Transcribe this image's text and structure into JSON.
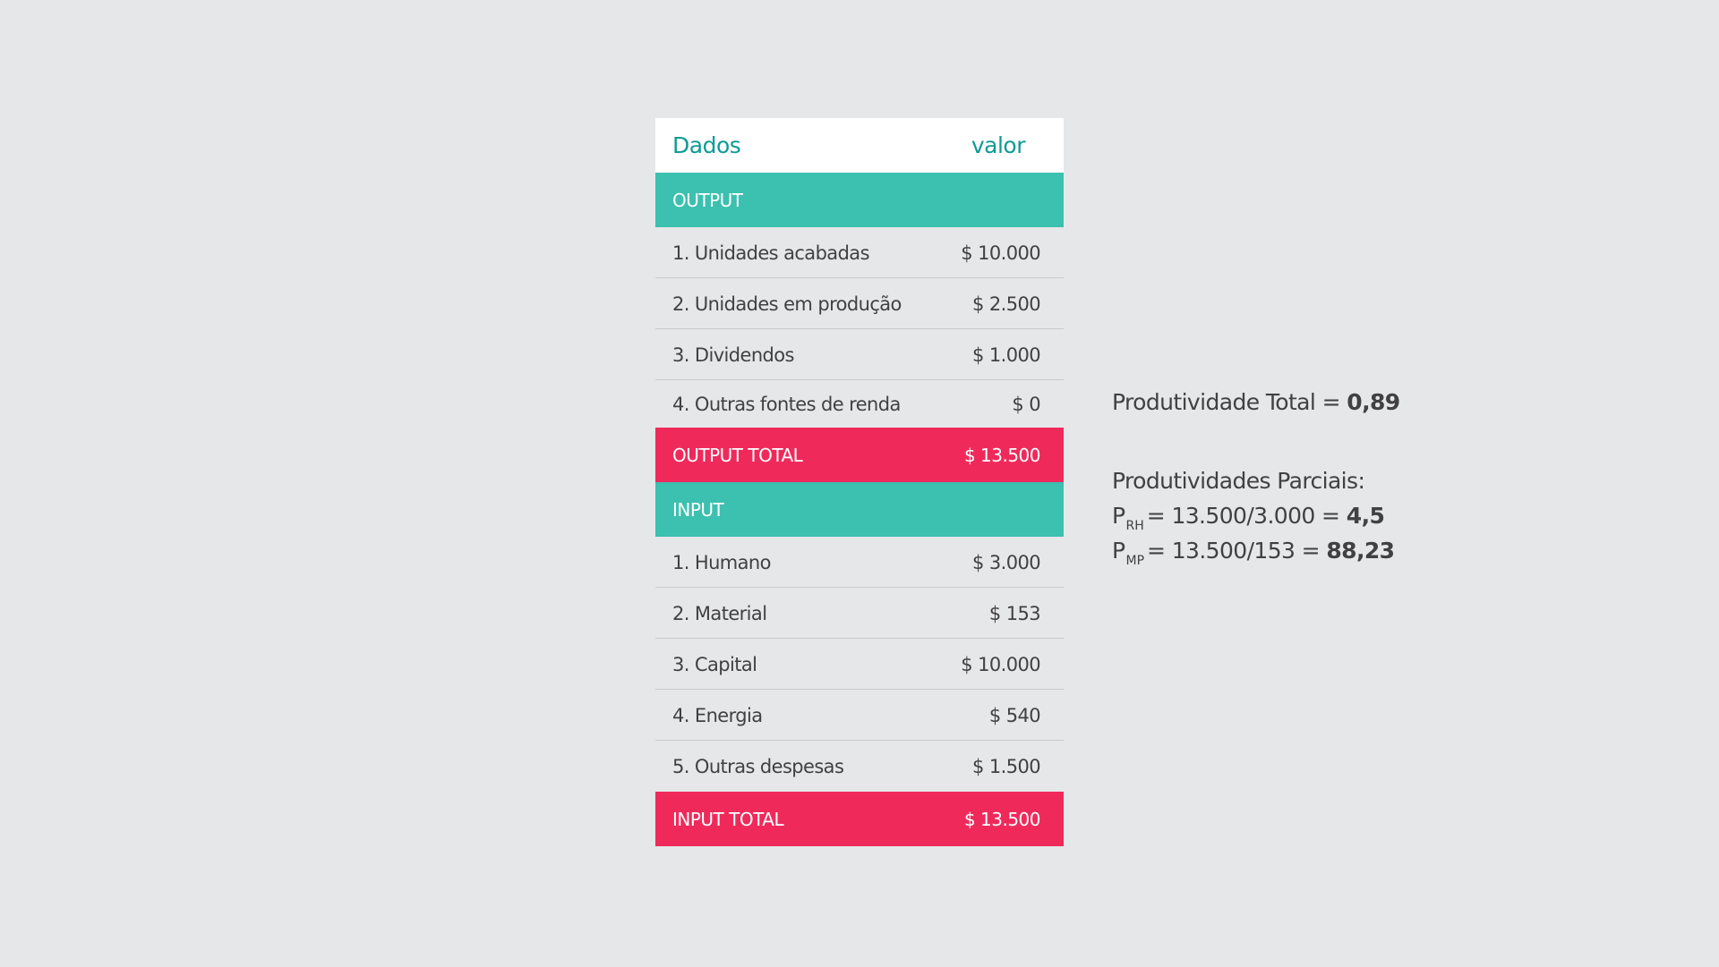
{
  "table": {
    "header": {
      "col1": "Dados",
      "col2": "valor"
    },
    "output_section": {
      "label": "OUTPUT"
    },
    "output_items": [
      {
        "label": "1. Unidades acabadas",
        "value": "$ 10.000"
      },
      {
        "label": "2. Unidades em produção",
        "value": "$ 2.500"
      },
      {
        "label": "3. Dividendos",
        "value": "$ 1.000"
      },
      {
        "label": "4. Outras fontes de renda",
        "value": "$ 0"
      }
    ],
    "output_total": {
      "label": "OUTPUT TOTAL",
      "value": "$ 13.500"
    },
    "input_section": {
      "label": "INPUT"
    },
    "input_items": [
      {
        "label": "1. Humano",
        "value": "$ 3.000"
      },
      {
        "label": "2. Material",
        "value": "$ 153"
      },
      {
        "label": "3. Capital",
        "value": "$ 10.000"
      },
      {
        "label": "4. Energia",
        "value": "$ 540"
      },
      {
        "label": "5. Outras despesas",
        "value": "$ 1.500"
      }
    ],
    "input_total": {
      "label": "INPUT TOTAL",
      "value": "$ 13.500"
    }
  },
  "side": {
    "total_label": "Produtividade Total =",
    "total_value": "0,89",
    "partial_title": "Produtividades Parciais:",
    "prh": {
      "p": "P",
      "sub": "RH",
      "expr": "= 13.500/3.000 =",
      "result": "4,5"
    },
    "pmp": {
      "p": "P",
      "sub": "MP",
      "expr": "= 13.500/153 =",
      "result": "88,23"
    }
  },
  "colors": {
    "background": "#e6e7e8",
    "teal_header_text": "#0e9a96",
    "section_teal": "#3cc0af",
    "total_pink": "#ef2a5b",
    "text": "#414042"
  }
}
